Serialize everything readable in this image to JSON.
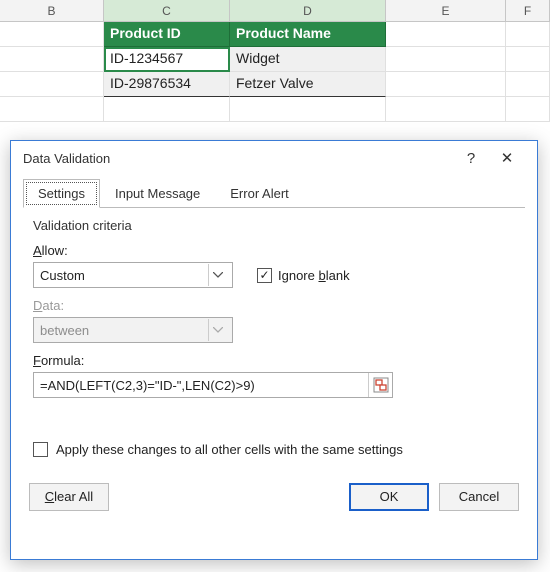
{
  "sheet": {
    "columns": [
      "B",
      "C",
      "D",
      "E",
      "F"
    ],
    "headers": {
      "C": "Product ID",
      "D": "Product Name"
    },
    "rows": [
      {
        "C": "ID-1234567",
        "D": "Widget"
      },
      {
        "C": "ID-29876534",
        "D": "Fetzer Valve"
      }
    ]
  },
  "dialog": {
    "title": "Data Validation",
    "help_glyph": "?",
    "close_glyph": "✕",
    "tabs": {
      "settings": "Settings",
      "input_message": "Input Message",
      "error_alert": "Error Alert"
    },
    "section": "Validation criteria",
    "allow": {
      "label_pre": "",
      "label_u": "A",
      "label_post": "llow:",
      "value": "Custom"
    },
    "ignore_blank": {
      "label_pre": "Ignore ",
      "label_u": "b",
      "label_post": "lank",
      "checked": "✓"
    },
    "data": {
      "label_pre": "",
      "label_u": "D",
      "label_post": "ata:",
      "value": "between"
    },
    "formula": {
      "label_pre": "",
      "label_u": "F",
      "label_post": "ormula:",
      "value": "=AND(LEFT(C2,3)=\"ID-\",LEN(C2)>9)"
    },
    "apply": {
      "checked": "",
      "label_pre": "Apply these changes to all other cells with the same settings"
    },
    "buttons": {
      "clear_all_u": "C",
      "clear_all_rest": "lear All",
      "ok": "OK",
      "cancel": "Cancel"
    }
  }
}
